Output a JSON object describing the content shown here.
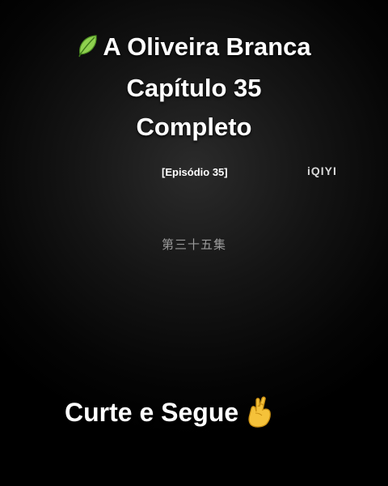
{
  "title": {
    "line1": "A Oliveira Branca",
    "line2": "Capítulo 35",
    "line3": "Completo",
    "leading_icon": "leaf-icon"
  },
  "subtitle": {
    "episode": "[Episódio 35]"
  },
  "watermark": {
    "brand": "iQIYI"
  },
  "chinese_caption": "第三十五集",
  "call_to_action": {
    "text": "Curte e Segue",
    "trailing_icon": "crossed-fingers-hand-icon"
  },
  "colors": {
    "background": "#000000",
    "text": "#ffffff",
    "leaf": "#7ac943",
    "hand": "#f5c23a"
  }
}
